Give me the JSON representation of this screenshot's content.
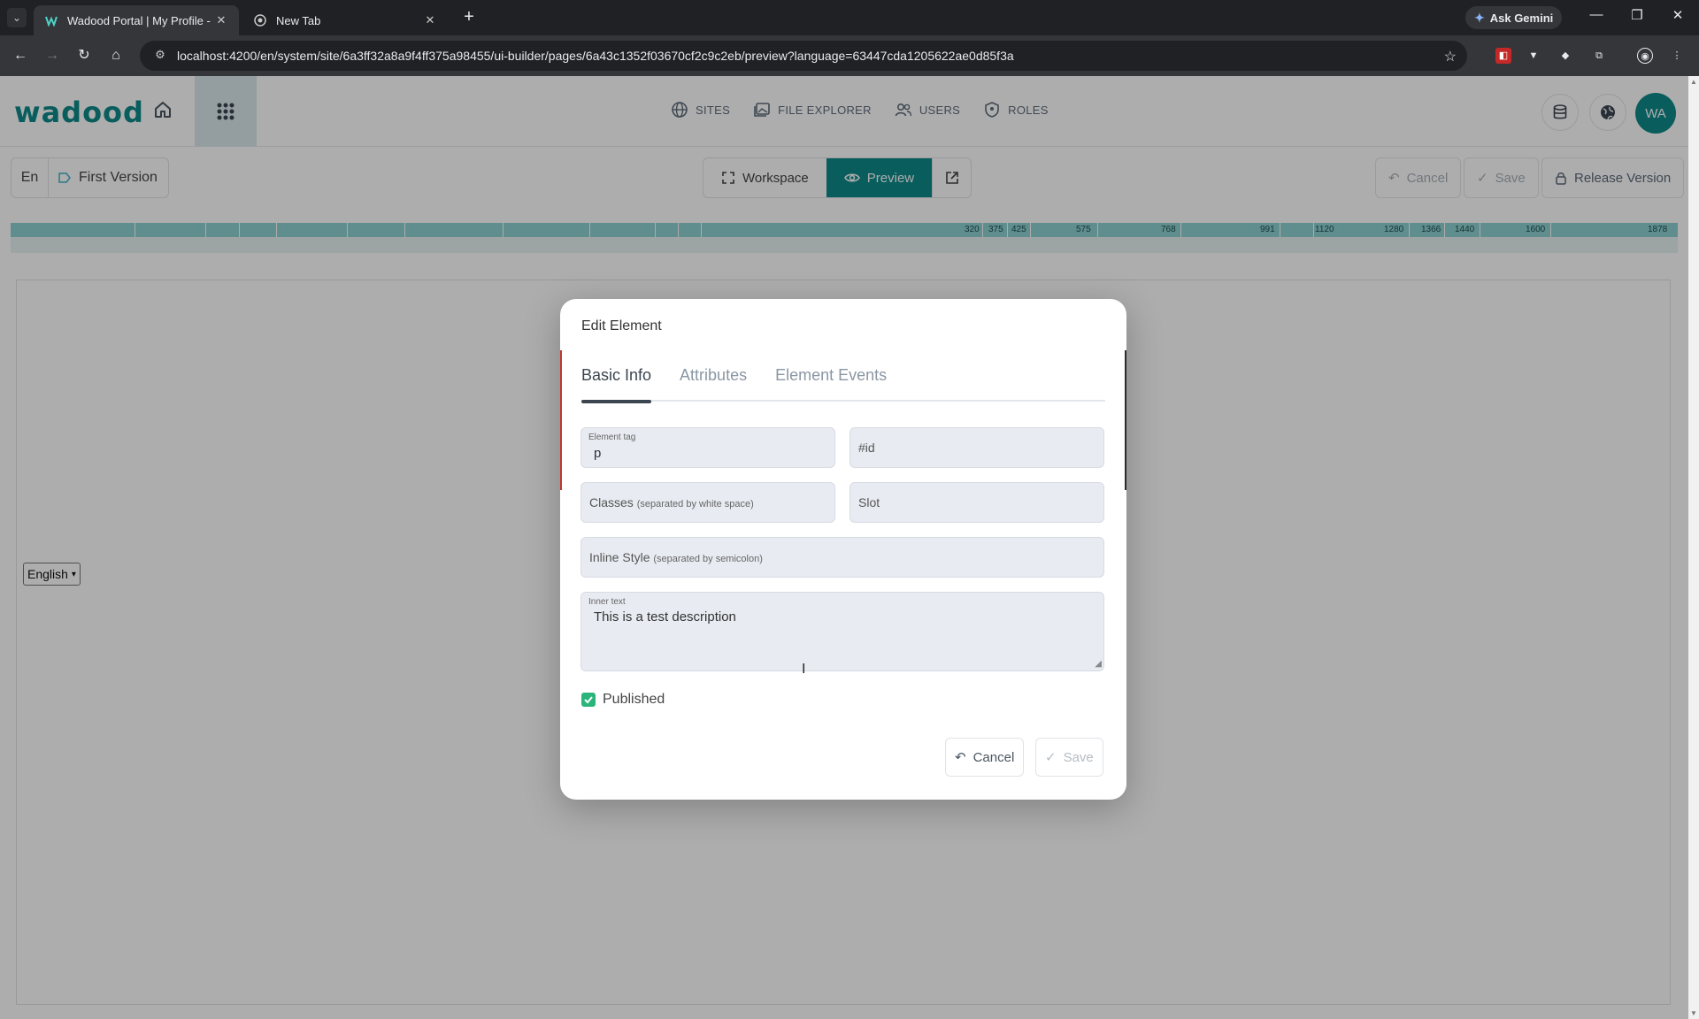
{
  "browser": {
    "tabs": [
      {
        "title": "Wadood Portal | My Profile - U",
        "active": true
      },
      {
        "title": "New Tab",
        "active": false
      }
    ],
    "gemini_label": "Ask Gemini",
    "url": "localhost:4200/en/system/site/6a3ff32a8a9f4ff375a98455/ui-builder/pages/6a43c1352f03670cf2c9c2eb/preview?language=63447cda1205622ae0d85f3a"
  },
  "header": {
    "logo": "wadood",
    "nav": [
      {
        "label": "SITES",
        "icon": "globe-icon"
      },
      {
        "label": "FILE EXPLORER",
        "icon": "images-icon"
      },
      {
        "label": "USERS",
        "icon": "users-icon"
      },
      {
        "label": "ROLES",
        "icon": "shield-icon"
      }
    ],
    "avatar": "WA"
  },
  "subbar": {
    "language": "En",
    "version": "First Version",
    "modes": {
      "workspace": "Workspace",
      "preview": "Preview"
    },
    "cancel": "Cancel",
    "save": "Save",
    "release": "Release Version"
  },
  "ruler": {
    "labels": [
      "320",
      "375",
      "425",
      "575",
      "768",
      "991",
      "1120",
      "1280",
      "1366",
      "1440",
      "1600",
      "1878"
    ]
  },
  "canvas": {
    "language_select": "English"
  },
  "dialog": {
    "title": "Edit Element",
    "tabs": [
      "Basic Info",
      "Attributes",
      "Element Events"
    ],
    "element_tag_label": "Element tag",
    "element_tag_value": "p",
    "id_placeholder": "#id",
    "classes_placeholder": "Classes",
    "classes_hint": "(separated by white space)",
    "slot_placeholder": "Slot",
    "style_placeholder": "Inline Style",
    "style_hint": "(separated by semicolon)",
    "inner_text_label": "Inner text",
    "inner_text_value": "This is a test description",
    "published_label": "Published",
    "published": true,
    "cancel": "Cancel",
    "save": "Save"
  },
  "colors": {
    "brand": "#0e8a8a",
    "checkbox": "#2bb57a"
  }
}
